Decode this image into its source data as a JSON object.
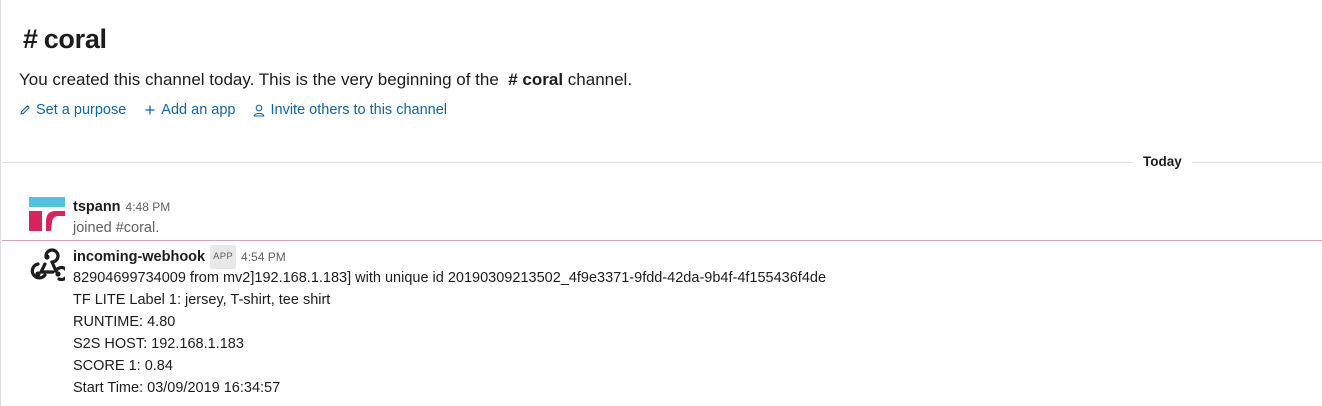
{
  "channel": {
    "hash": "#",
    "name": "coral"
  },
  "intro": {
    "text_before": "You created this channel today. This is the very beginning of the",
    "channel_ref": "# coral",
    "text_after": "channel."
  },
  "actions": [
    {
      "icon": "pencil-icon",
      "label": "Set a purpose"
    },
    {
      "icon": "plus-icon",
      "label": "Add an app"
    },
    {
      "icon": "person-icon",
      "label": "Invite others to this channel"
    }
  ],
  "day_divider": "Today",
  "messages": [
    {
      "sender": "tspann",
      "time": "4:48 PM",
      "lines": [
        "joined #coral."
      ],
      "avatar_colors": {
        "top": "#4fc3e0",
        "bottom": "#d6245c"
      }
    },
    {
      "sender": "incoming-webhook",
      "badge": "APP",
      "time": "4:54 PM",
      "lines": [
        "82904699734009 from mv2]192.168.1.183] with unique id 20190309213502_4f9e3371-9fdd-42da-9b4f-4f155436f4de",
        "TF LITE Label 1: jersey, T-shirt, tee shirt",
        "RUNTIME: 4.80",
        "S2S HOST: 192.168.1.183",
        "SCORE 1: 0.84",
        "Start Time: 03/09/2019 16:34:57"
      ]
    }
  ],
  "colors": {
    "link": "#1264a3",
    "new_message_line": "#d6a3b4"
  }
}
